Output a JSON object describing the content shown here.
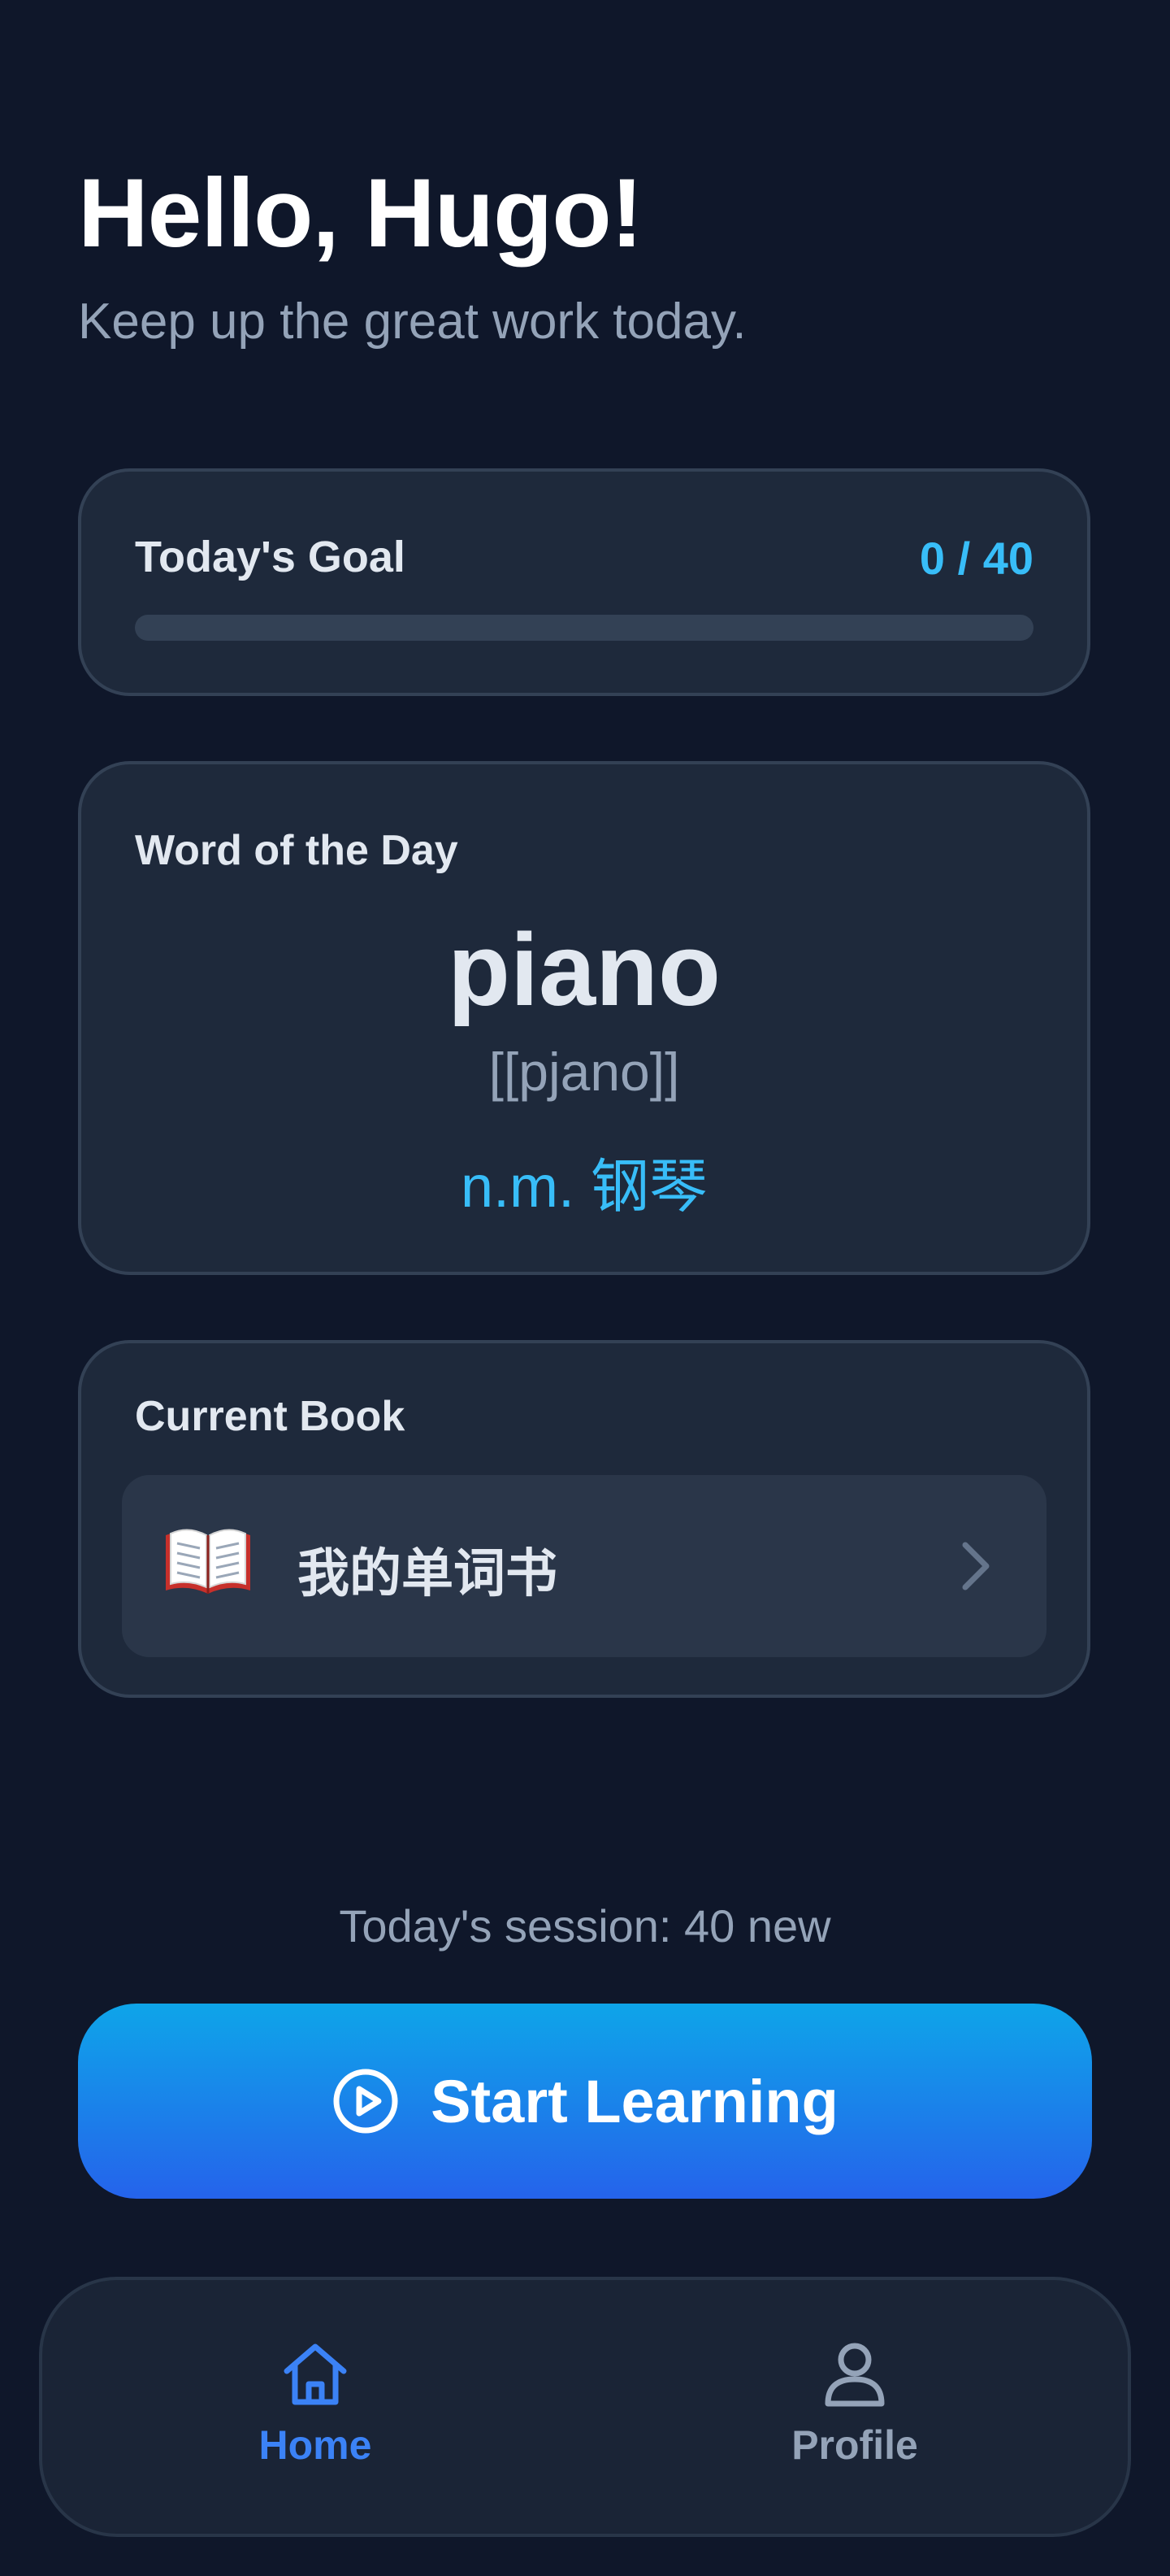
{
  "header": {
    "greeting": "Hello, Hugo!",
    "subtitle": "Keep up the great work today."
  },
  "goal": {
    "label": "Today's Goal",
    "count_text": "0 / 40",
    "progress_fraction": 0
  },
  "word_of_day": {
    "heading": "Word of the Day",
    "word": "piano",
    "phonetic": "[[pjano]]",
    "definition": "n.m. 钢琴"
  },
  "current_book": {
    "heading": "Current Book",
    "title": "我的单词书",
    "icon": "open-book-icon"
  },
  "session": {
    "text": "Today's session: 40 new"
  },
  "start_button": {
    "label": "Start Learning",
    "icon": "play-circle-icon"
  },
  "nav": {
    "items": [
      {
        "label": "Home",
        "icon": "home-icon",
        "active": true
      },
      {
        "label": "Profile",
        "icon": "user-icon",
        "active": false
      }
    ]
  },
  "colors": {
    "background": "#0f172a",
    "card": "#1e293b",
    "accent": "#38bdf8",
    "button_top": "#0ea5e9",
    "button_bottom": "#2563eb",
    "nav_active": "#3b82f6"
  }
}
